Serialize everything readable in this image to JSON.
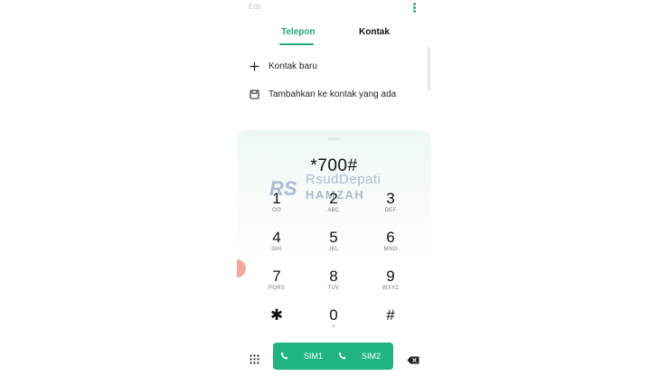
{
  "header": {
    "edit_label": "Edit"
  },
  "tabs": [
    {
      "label": "Telepon",
      "active": true
    },
    {
      "label": "Kontak",
      "active": false
    }
  ],
  "actions": [
    {
      "icon": "plus-icon",
      "label": "Kontak baru"
    },
    {
      "icon": "save-icon",
      "label": "Tambahkan ke kontak yang ada"
    }
  ],
  "dialer": {
    "number": "*700#",
    "keys": [
      {
        "digit": "1",
        "letters": "OO"
      },
      {
        "digit": "2",
        "letters": "ABC"
      },
      {
        "digit": "3",
        "letters": "DEF"
      },
      {
        "digit": "4",
        "letters": "GHI"
      },
      {
        "digit": "5",
        "letters": "JKL"
      },
      {
        "digit": "6",
        "letters": "MNO"
      },
      {
        "digit": "7",
        "letters": "PQRS"
      },
      {
        "digit": "8",
        "letters": "TUV"
      },
      {
        "digit": "9",
        "letters": "WXYZ"
      },
      {
        "digit": "✱",
        "letters": ""
      },
      {
        "digit": "0",
        "letters": "+"
      },
      {
        "digit": "#",
        "letters": ""
      }
    ]
  },
  "watermark": {
    "mark": "RS",
    "line1": "RsudDepati",
    "line2": "HAMZAH"
  },
  "call_bar": {
    "sim1_label": "SIM1",
    "sim2_label": "SIM2"
  },
  "colors": {
    "accent": "#1fa97a",
    "call_button": "#1fb481"
  }
}
